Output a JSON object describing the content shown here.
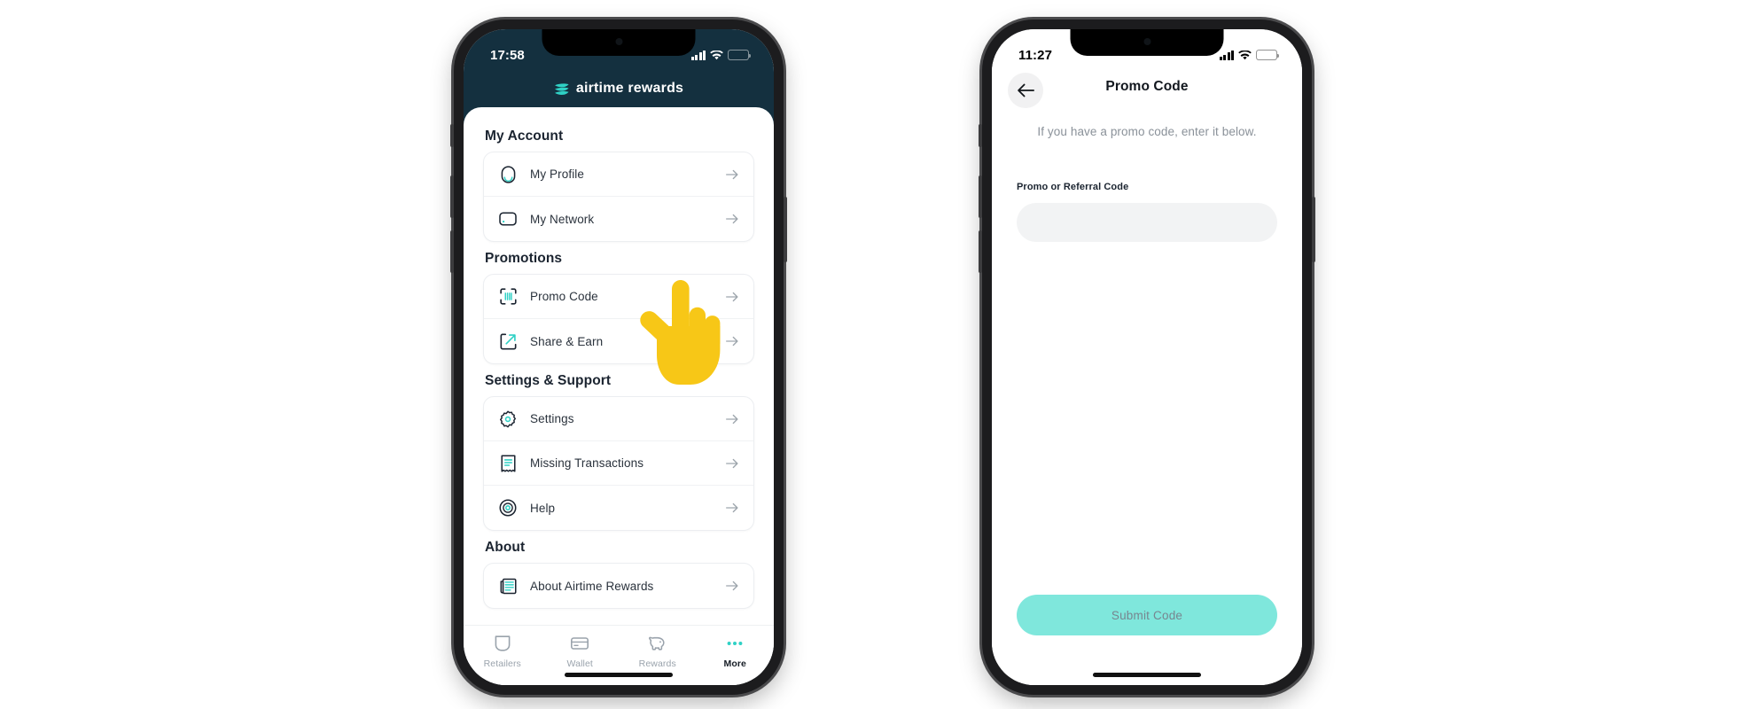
{
  "colors": {
    "brand_navy": "#14303F",
    "brand_teal": "#2FD1C5",
    "submit_button": "#7FE7DC",
    "submit_text": "#77858F",
    "input_bg": "#F2F3F4",
    "battery_low_power": "#F6CE2D"
  },
  "left_phone": {
    "status_bar": {
      "clock": "17:58",
      "signal_icon": "cellular-signal-icon",
      "wifi_icon": "wifi-icon",
      "battery_icon": "battery-low-power-icon"
    },
    "brand": {
      "logo_icon": "airtime-waves-logo-icon",
      "name": "airtime rewards"
    },
    "sections": [
      {
        "title": "My Account",
        "items": [
          {
            "label": "My Profile",
            "icon": "user-profile-icon",
            "arrow": "arrow-right-icon"
          },
          {
            "label": "My Network",
            "icon": "network-card-icon",
            "arrow": "arrow-right-icon"
          }
        ]
      },
      {
        "title": "Promotions",
        "items": [
          {
            "label": "Promo Code",
            "icon": "barcode-scan-icon",
            "arrow": "arrow-right-icon"
          },
          {
            "label": "Share & Earn",
            "icon": "share-external-link-icon",
            "arrow": "arrow-right-icon"
          }
        ]
      },
      {
        "title": "Settings & Support",
        "items": [
          {
            "label": "Settings",
            "icon": "gear-icon",
            "arrow": "arrow-right-icon"
          },
          {
            "label": "Missing Transactions",
            "icon": "receipt-icon",
            "arrow": "arrow-right-icon"
          },
          {
            "label": "Help",
            "icon": "lifebuoy-icon",
            "arrow": "arrow-right-icon"
          }
        ]
      },
      {
        "title": "About",
        "items": [
          {
            "label": "About Airtime Rewards",
            "icon": "news-document-icon",
            "arrow": "arrow-right-icon"
          }
        ]
      }
    ],
    "tab_bar": [
      {
        "label": "Retailers",
        "icon": "shopping-bag-icon",
        "active": false
      },
      {
        "label": "Wallet",
        "icon": "credit-card-icon",
        "active": false
      },
      {
        "label": "Rewards",
        "icon": "piggy-bank-icon",
        "active": false
      },
      {
        "label": "More",
        "icon": "three-dots-icon",
        "active": true
      }
    ],
    "cursor": {
      "icon": "pointing-hand-cursor"
    }
  },
  "right_phone": {
    "status_bar": {
      "clock": "11:27",
      "signal_icon": "cellular-signal-icon",
      "wifi_icon": "wifi-icon",
      "battery_icon": "battery-full-icon"
    },
    "nav": {
      "back_icon": "arrow-left-icon",
      "title": "Promo Code"
    },
    "description": "If you have a promo code, enter it below.",
    "field_label": "Promo or Referral Code",
    "input_value": "",
    "input_placeholder": "",
    "submit_label": "Submit Code"
  }
}
